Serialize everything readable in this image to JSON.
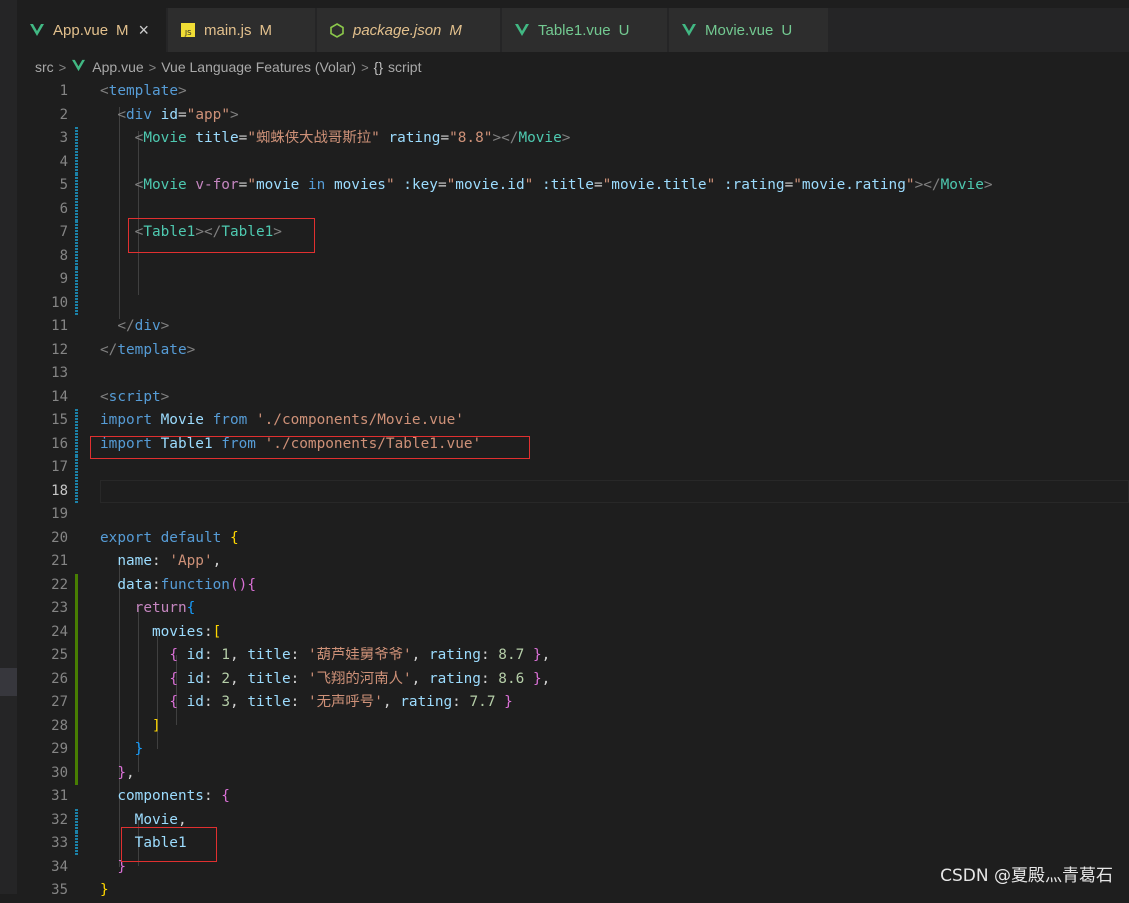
{
  "tabs": [
    {
      "label": "App.vue",
      "status": "M",
      "icon": "vue-icon",
      "active": true,
      "italic": false,
      "label_color": "#e2c08d",
      "status_color": "#e2c08d"
    },
    {
      "label": "main.js",
      "status": "M",
      "icon": "js-icon",
      "active": false,
      "italic": false,
      "label_color": "#e2c08d",
      "status_color": "#e2c08d"
    },
    {
      "label": "package.json",
      "status": "M",
      "icon": "nodejs-icon",
      "active": false,
      "italic": true,
      "label_color": "#e2c08d",
      "status_color": "#e2c08d"
    },
    {
      "label": "Table1.vue",
      "status": "U",
      "icon": "vue-icon",
      "active": false,
      "italic": false,
      "label_color": "#73c991",
      "status_color": "#73c991"
    },
    {
      "label": "Movie.vue",
      "status": "U",
      "icon": "vue-icon",
      "active": false,
      "italic": false,
      "label_color": "#73c991",
      "status_color": "#73c991"
    }
  ],
  "tab_close_glyph": "×",
  "breadcrumb": {
    "segments": [
      "src",
      "App.vue",
      "Vue Language Features (Volar)",
      "script"
    ],
    "separator": ">",
    "script_icon": "{}"
  },
  "current_line": "18",
  "line_numbers": [
    "1",
    "2",
    "3",
    "4",
    "5",
    "6",
    "7",
    "8",
    "9",
    "10",
    "11",
    "12",
    "13",
    "14",
    "15",
    "16",
    "17",
    "18",
    "19",
    "20",
    "21",
    "22",
    "23",
    "24",
    "25",
    "26",
    "27",
    "28",
    "29",
    "30",
    "31",
    "32",
    "33",
    "34",
    "35"
  ],
  "code": {
    "l1": {
      "t0": "<",
      "t1": "template",
      "t2": ">"
    },
    "l2": {
      "t0": "  <",
      "t1": "div",
      "t2": " id",
      "t3": "=",
      "t4": "\"app\"",
      "t5": ">"
    },
    "l3": {
      "t0": "    <",
      "t1": "Movie",
      "t2": " title",
      "t3": "=",
      "t4": "\"蜘蛛侠大战哥斯拉\"",
      "t5": " rating",
      "t6": "=",
      "t7": "\"8.8\"",
      "t8": "></",
      "t9": "Movie",
      "t10": ">"
    },
    "l5": {
      "t0": "    <",
      "t1": "Movie",
      "t2": " v-for",
      "t3": "=",
      "t4": "\"",
      "t5": "movie",
      "t6": " in ",
      "t7": "movies",
      "t8": "\"",
      "t9": " :key",
      "t10": "=",
      "t11": "\"",
      "t12": "movie.id",
      "t13": "\"",
      "t14": " :title",
      "t15": "=",
      "t16": "\"",
      "t17": "movie.title",
      "t18": "\"",
      "t19": " :rating",
      "t20": "=",
      "t21": "\"",
      "t22": "movie.rating",
      "t23": "\"",
      "t24": "></",
      "t25": "Movie",
      "t26": ">"
    },
    "l7": {
      "t0": "    <",
      "t1": "Table1",
      "t2": "></",
      "t3": "Table1",
      "t4": ">"
    },
    "l11": {
      "t0": "  </",
      "t1": "div",
      "t2": ">"
    },
    "l12": {
      "t0": "</",
      "t1": "template",
      "t2": ">"
    },
    "l14": {
      "t0": "<",
      "t1": "script",
      "t2": ">"
    },
    "l15": {
      "t0": "import",
      "t1": " Movie ",
      "t2": "from",
      "t3": " './components/Movie.vue'"
    },
    "l16": {
      "t0": "import",
      "t1": " Table1 ",
      "t2": "from",
      "t3": " './components/Table1.vue'"
    },
    "l20": {
      "t0": "export",
      "t1": " default",
      "t2": " ",
      "t3": "{"
    },
    "l21": {
      "t0": "  name",
      "t1": ": ",
      "t2": "'App'",
      "t3": ","
    },
    "l22": {
      "t0": "  data",
      "t1": ":",
      "t2": "function",
      "t3": "(",
      "t4": ")",
      "t5": "{"
    },
    "l23": {
      "t0": "    return",
      "t1": "{"
    },
    "l24": {
      "t0": "      movies",
      "t1": ":",
      "t2": "["
    },
    "l25": {
      "t0": "        ",
      "t1": "{",
      "t2": " id",
      "t3": ": ",
      "t4": "1",
      "t5": ", ",
      "t6": "title",
      "t7": ": ",
      "t8": "'葫芦娃舅爷爷'",
      "t9": ", ",
      "t10": "rating",
      "t11": ": ",
      "t12": "8.7",
      "t13": " ",
      "t14": "}",
      "t15": ","
    },
    "l26": {
      "t0": "        ",
      "t1": "{",
      "t2": " id",
      "t3": ": ",
      "t4": "2",
      "t5": ", ",
      "t6": "title",
      "t7": ": ",
      "t8": "'飞翔的河南人'",
      "t9": ", ",
      "t10": "rating",
      "t11": ": ",
      "t12": "8.6",
      "t13": " ",
      "t14": "}",
      "t15": ","
    },
    "l27": {
      "t0": "        ",
      "t1": "{",
      "t2": " id",
      "t3": ": ",
      "t4": "3",
      "t5": ", ",
      "t6": "title",
      "t7": ": ",
      "t8": "'无声呼号'",
      "t9": ", ",
      "t10": "rating",
      "t11": ": ",
      "t12": "7.7",
      "t13": " ",
      "t14": "}"
    },
    "l28": {
      "t0": "      ",
      "t1": "]"
    },
    "l29": {
      "t0": "    ",
      "t1": "}"
    },
    "l30": {
      "t0": "  ",
      "t1": "}",
      "t2": ","
    },
    "l31": {
      "t0": "  components",
      "t1": ": ",
      "t2": "{"
    },
    "l32": {
      "t0": "    Movie",
      "t1": ","
    },
    "l33": {
      "t0": "    Table1"
    },
    "l34": {
      "t0": "  ",
      "t1": "}"
    },
    "l35": {
      "t0": "}"
    }
  },
  "watermark": "CSDN @夏殿灬青葛石"
}
